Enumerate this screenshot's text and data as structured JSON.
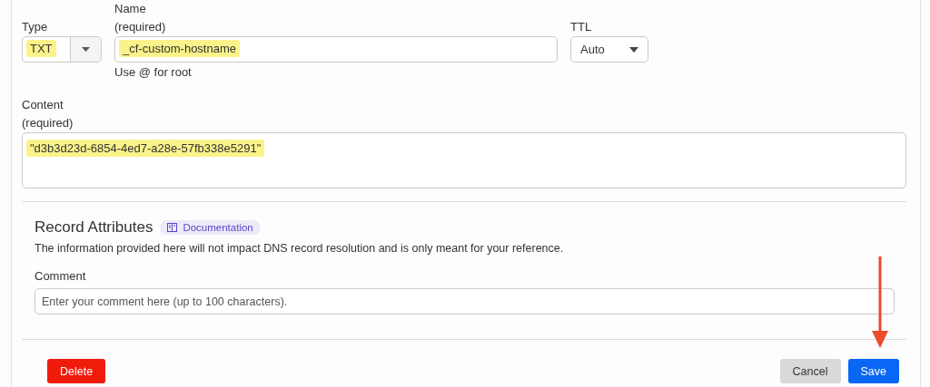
{
  "type_field": {
    "label": "Type",
    "value": "TXT",
    "highlighted": true
  },
  "name_field": {
    "label": "Name",
    "sublabel": "(required)",
    "value": "_cf-custom-hostname",
    "highlighted": true,
    "hint": "Use @ for root"
  },
  "ttl_field": {
    "label": "TTL",
    "value": "Auto"
  },
  "content_field": {
    "label": "Content",
    "sublabel": "(required)",
    "value": "\"d3b3d23d-6854-4ed7-a28e-57fb338e5291\"",
    "highlighted": true
  },
  "record_attributes": {
    "title": "Record Attributes",
    "doc_link": "Documentation",
    "description": "The information provided here will not impact DNS record resolution and is only meant for your reference.",
    "comment_label": "Comment",
    "comment_placeholder": "Enter your comment here (up to 100 characters)."
  },
  "buttons": [
    {
      "kind": "danger",
      "label": "Delete"
    },
    {
      "kind": "secondary",
      "label": "Cancel"
    },
    {
      "kind": "primary",
      "label": "Save"
    }
  ],
  "pointer_arrow": true
}
